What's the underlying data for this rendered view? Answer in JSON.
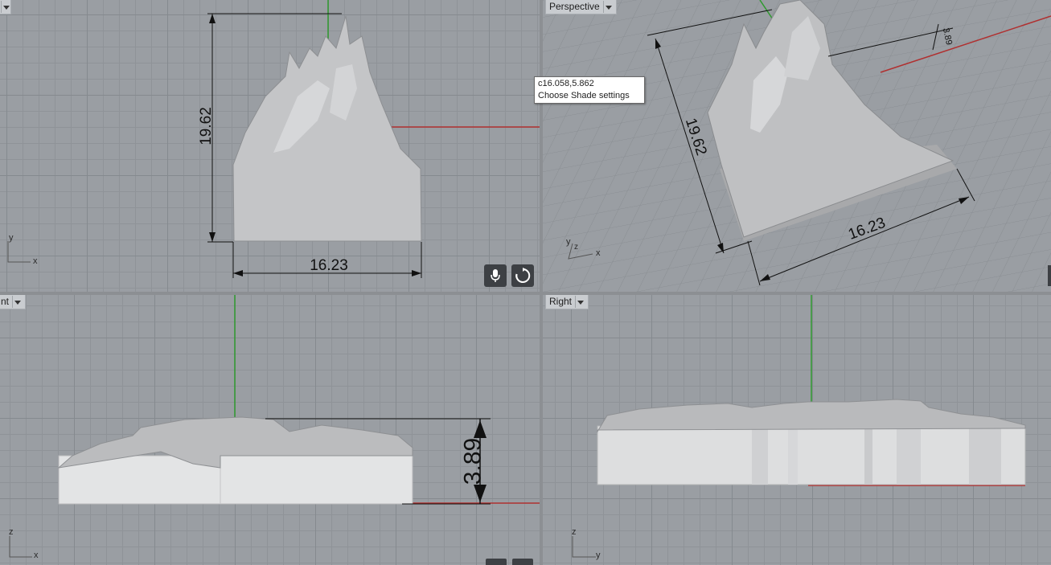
{
  "viewports": {
    "top": {
      "label": "",
      "dim_height": "19.62",
      "dim_width": "16.23"
    },
    "perspective": {
      "label": "Perspective",
      "dim_height": "19.62",
      "dim_width": "16.23",
      "dim_depth": "3.89"
    },
    "front": {
      "label": "nt",
      "dim_depth": "3.89"
    },
    "right": {
      "label": "Right"
    }
  },
  "axes": {
    "x": "x",
    "y": "y",
    "z": "z"
  },
  "tooltip": {
    "coords": "c16.058,5.862",
    "text": "Choose Shade settings"
  },
  "icons": [
    "dropdown-arrow-icon",
    "microphone-icon",
    "rotate-icon"
  ],
  "colors": {
    "viewport_bg": "#9a9ea3",
    "x_axis": "#b03030",
    "y_axis": "#2f9a2f",
    "model": "#c8c9cb"
  }
}
